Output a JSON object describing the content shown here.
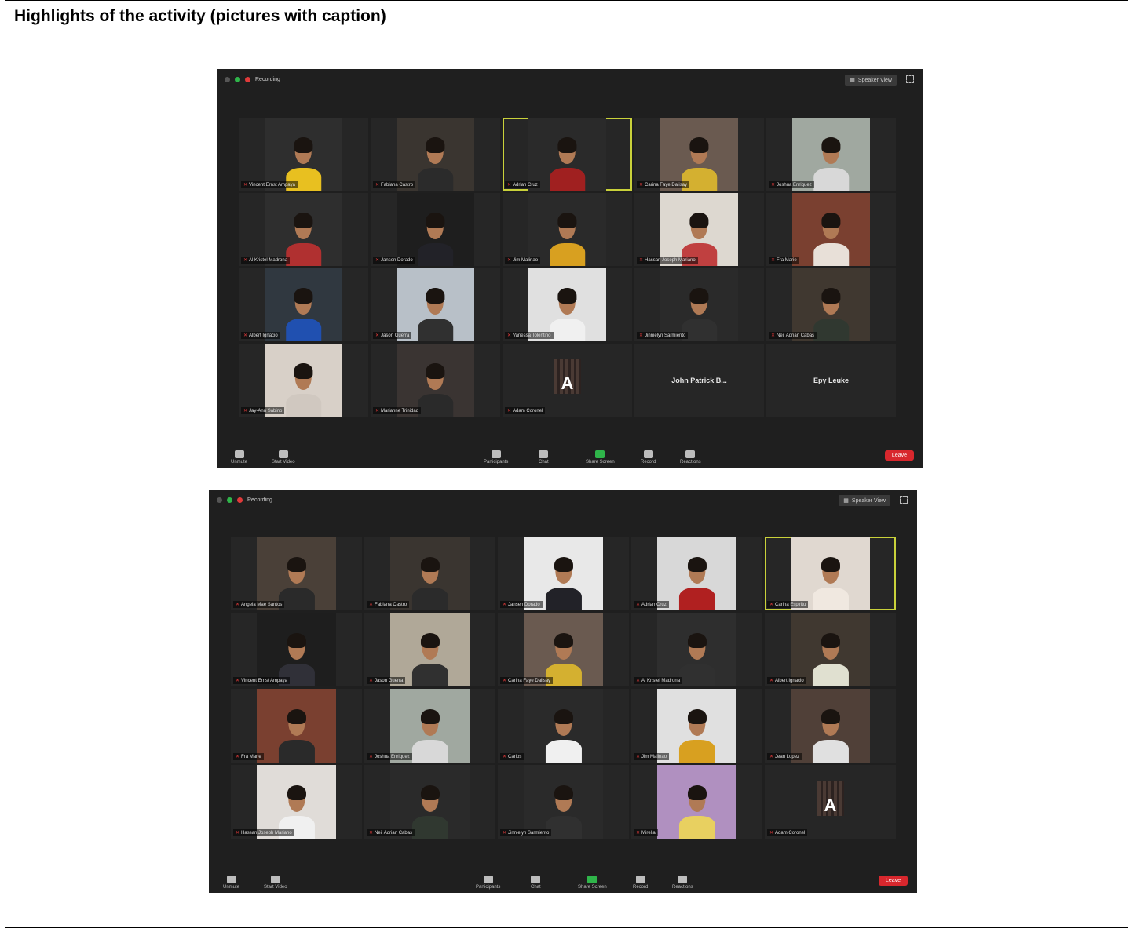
{
  "heading": "Highlights of the activity (pictures with caption)",
  "screenshots": [
    {
      "recording_label": "Recording",
      "view_button": "Speaker View",
      "end_label": "Leave",
      "toolbar": [
        "Unmute",
        "Start Video",
        "Participants",
        "Chat",
        "Share Screen",
        "Record",
        "Reactions"
      ],
      "tiles": [
        {
          "label": "Vincent Ernst Ampaya",
          "bg": "#2e2e2e",
          "shirt": "#e8c020"
        },
        {
          "label": "Fabiana Castro",
          "bg": "#3a3530",
          "shirt": "#2b2b2b"
        },
        {
          "label": "Adrian Cruz",
          "bg": "#2a2a2a",
          "shirt": "#a02020",
          "active": true
        },
        {
          "label": "Carina Faye Dalisay",
          "bg": "#6a5a50",
          "shirt": "#d4b030"
        },
        {
          "label": "Joshua Enriquez",
          "bg": "#a0a8a0",
          "shirt": "#d8d8d8"
        },
        {
          "label": "Al Kristel Madrona",
          "bg": "#2e2e2e",
          "shirt": "#b03030"
        },
        {
          "label": "Jansen Dorado",
          "bg": "#1e1e1e",
          "shirt": "#222228"
        },
        {
          "label": "Jim Malinao",
          "bg": "#2a2a2a",
          "shirt": "#d8a020"
        },
        {
          "label": "Hassan Joseph Mariano",
          "bg": "#ddd8d0",
          "shirt": "#c04040"
        },
        {
          "label": "Fra Marie",
          "bg": "#7a4030",
          "shirt": "#e8e0d8"
        },
        {
          "label": "Albert Ignacio",
          "bg": "#303840",
          "shirt": "#2050b0"
        },
        {
          "label": "Jason Guerra",
          "bg": "#b8c0c8",
          "shirt": "#303030"
        },
        {
          "label": "Vanessa Tolentino",
          "bg": "#e0e0e0",
          "shirt": "#f0f0f0"
        },
        {
          "label": "Jinnielyn Sarmiento",
          "bg": "#2a2a2a",
          "shirt": "#303030"
        },
        {
          "label": "Neil Adrian Cabas",
          "bg": "#403830",
          "shirt": "#303830"
        },
        {
          "label": "Jay-Ann Sabino",
          "bg": "#d8d0c8",
          "shirt": "#d0c8c0"
        },
        {
          "label": "Marianne Trinidad",
          "bg": "#3a3432",
          "shirt": "#2a2a2a"
        },
        {
          "label": "Adam Coronel",
          "bg": "#262626",
          "avatar": "A"
        },
        {
          "label": "",
          "bg": "#262626",
          "bigname": "John Patrick B..."
        },
        {
          "label": "",
          "bg": "#262626",
          "bigname": "Epy Leuke"
        }
      ]
    },
    {
      "recording_label": "Recording",
      "view_button": "Speaker View",
      "end_label": "Leave",
      "toolbar": [
        "Unmute",
        "Start Video",
        "Participants",
        "Chat",
        "Share Screen",
        "Record",
        "Reactions"
      ],
      "tiles": [
        {
          "label": "Angela Mae Santos",
          "bg": "#4a4038",
          "shirt": "#2a2a2a"
        },
        {
          "label": "Fabiana Castro",
          "bg": "#3a3530",
          "shirt": "#2b2b2b"
        },
        {
          "label": "Jansen Dorado",
          "bg": "#e8e8e8",
          "shirt": "#222228"
        },
        {
          "label": "Adrian Cruz",
          "bg": "#d8d8d8",
          "shirt": "#b02020"
        },
        {
          "label": "Carina Espiritu",
          "bg": "#e0d8d0",
          "shirt": "#f0e8e0",
          "active": true
        },
        {
          "label": "Vincent Ernst Ampaya",
          "bg": "#1e1e1e",
          "shirt": "#303038"
        },
        {
          "label": "Jason Guerra",
          "bg": "#b0a898",
          "shirt": "#303030"
        },
        {
          "label": "Carina Faye Dalisay",
          "bg": "#6a5a50",
          "shirt": "#d4b030"
        },
        {
          "label": "Al Kristel Madrona",
          "bg": "#2e2e2e",
          "shirt": "#303030"
        },
        {
          "label": "Albert Ignacio",
          "bg": "#403830",
          "shirt": "#e0e0d0"
        },
        {
          "label": "Fra Marie",
          "bg": "#7a4030",
          "shirt": "#2a2a2a"
        },
        {
          "label": "Joshua Enriquez",
          "bg": "#a0a8a0",
          "shirt": "#d8d8d8"
        },
        {
          "label": "Carlos",
          "bg": "#2a2a2a",
          "shirt": "#f0f0f0"
        },
        {
          "label": "Jim Malinao",
          "bg": "#e0e0e0",
          "shirt": "#d8a020"
        },
        {
          "label": "Jean Lopez",
          "bg": "#504038",
          "shirt": "#e0e0e0"
        },
        {
          "label": "Hassan Joseph Mariano",
          "bg": "#e0dcd8",
          "shirt": "#f0f0f0"
        },
        {
          "label": "Neil Adrian Cabas",
          "bg": "#2a2a2a",
          "shirt": "#303830"
        },
        {
          "label": "Jinnielyn Sarmiento",
          "bg": "#2a2a2a",
          "shirt": "#303030"
        },
        {
          "label": "Mirella",
          "bg": "#b090c0",
          "shirt": "#e8d060"
        },
        {
          "label": "Adam Coronel",
          "bg": "#262626",
          "avatar": "A"
        }
      ]
    }
  ]
}
